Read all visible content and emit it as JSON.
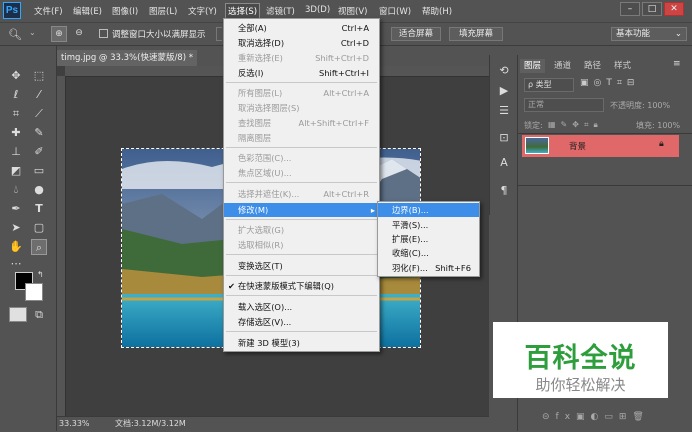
{
  "app": {
    "logo": "Ps"
  },
  "menubar": {
    "items": [
      "文件(F)",
      "编辑(E)",
      "图像(I)",
      "图层(L)",
      "文字(Y)",
      "选择(S)",
      "滤镜(T)",
      "3D(D)",
      "视图(V)",
      "窗口(W)",
      "帮助(H)"
    ],
    "active_index": 5,
    "window_buttons": {
      "minimize": "–",
      "restore": "□",
      "close": "✕"
    }
  },
  "optionsbar": {
    "checkbox_label": "调整窗口大小以满屏显示",
    "fit_screen": "适合屏幕",
    "fill_screen": "填充屏幕",
    "workspace": "基本功能"
  },
  "document": {
    "tab_title": "timg.jpg @ 33.3%(快速蒙版/8) *",
    "zoom": "33.33%",
    "doc_size": "文档:3.12M/3.12M"
  },
  "select_menu": {
    "items": [
      {
        "label": "全部(A)",
        "shortcut": "Ctrl+A",
        "disabled": false
      },
      {
        "label": "取消选择(D)",
        "shortcut": "Ctrl+D",
        "disabled": false
      },
      {
        "label": "重新选择(E)",
        "shortcut": "Shift+Ctrl+D",
        "disabled": true
      },
      {
        "label": "反选(I)",
        "shortcut": "Shift+Ctrl+I",
        "disabled": false
      },
      {
        "label": "所有图层(L)",
        "shortcut": "Alt+Ctrl+A",
        "disabled": true
      },
      {
        "label": "取消选择图层(S)",
        "shortcut": "",
        "disabled": true
      },
      {
        "label": "查找图层",
        "shortcut": "Alt+Shift+Ctrl+F",
        "disabled": true
      },
      {
        "label": "隔离图层",
        "shortcut": "",
        "disabled": true
      },
      {
        "label": "色彩范围(C)...",
        "shortcut": "",
        "disabled": true
      },
      {
        "label": "焦点区域(U)...",
        "shortcut": "",
        "disabled": true
      },
      {
        "label": "选择并遮住(K)...",
        "shortcut": "Alt+Ctrl+R",
        "disabled": true
      },
      {
        "label": "修改(M)",
        "shortcut": "",
        "disabled": false,
        "highlighted": true
      },
      {
        "label": "扩大选取(G)",
        "shortcut": "",
        "disabled": true
      },
      {
        "label": "选取相似(R)",
        "shortcut": "",
        "disabled": true
      },
      {
        "label": "变换选区(T)",
        "shortcut": "",
        "disabled": false
      },
      {
        "label": "在快速蒙版模式下编辑(Q)",
        "shortcut": "",
        "disabled": false,
        "checked": true
      },
      {
        "label": "载入选区(O)...",
        "shortcut": "",
        "disabled": false
      },
      {
        "label": "存储选区(V)...",
        "shortcut": "",
        "disabled": false
      },
      {
        "label": "新建 3D 模型(3)",
        "shortcut": "",
        "disabled": false
      }
    ]
  },
  "modify_submenu": {
    "items": [
      {
        "label": "边界(B)...",
        "shortcut": "",
        "highlighted": true
      },
      {
        "label": "平滑(S)...",
        "shortcut": ""
      },
      {
        "label": "扩展(E)...",
        "shortcut": ""
      },
      {
        "label": "收缩(C)...",
        "shortcut": ""
      },
      {
        "label": "羽化(F)...",
        "shortcut": "Shift+F6"
      }
    ]
  },
  "layers_panel": {
    "tabs": [
      "图层",
      "通道",
      "路径",
      "样式"
    ],
    "kind_filter": "ρ 类型",
    "blend_mode": "正常",
    "opacity_label": "不透明度: 100%",
    "lock_label": "锁定:",
    "fill_label": "填充: 100%",
    "layer_name": "背景"
  },
  "watermark": {
    "title": "百科全说",
    "subtitle": "助你轻松解决",
    "title_color": "#2e9e3c"
  }
}
